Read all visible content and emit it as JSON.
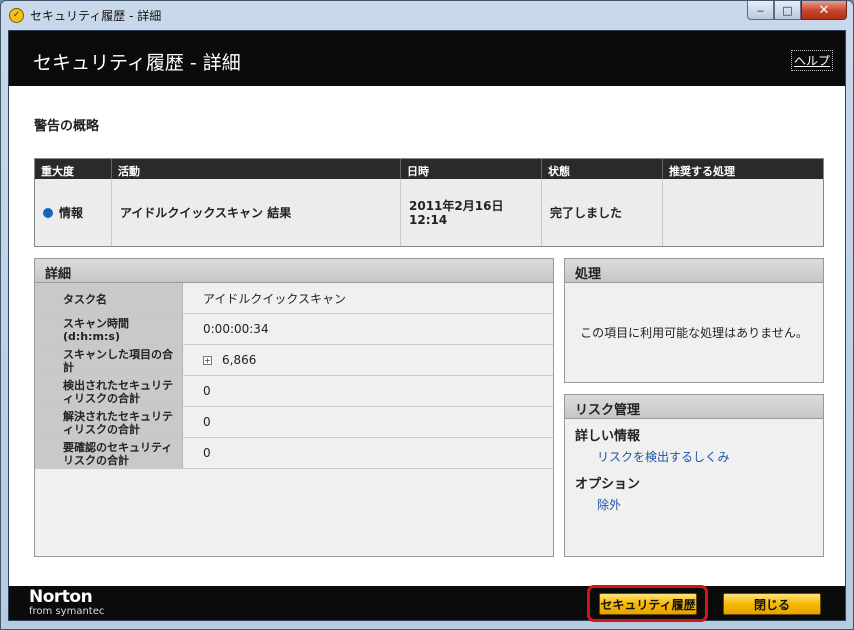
{
  "window": {
    "title": "セキュリティ履歴 - 詳細",
    "app_icon": "norton-icon",
    "controls": {
      "minimize": "‒",
      "maximize": "□",
      "close": "✕"
    }
  },
  "header": {
    "title": "セキュリティ履歴 - 詳細",
    "help_label": "ヘルプ"
  },
  "summary": {
    "title": "警告の概略",
    "columns": [
      "重大度",
      "活動",
      "日時",
      "状態",
      "推奨する処理"
    ],
    "row": {
      "severity": "情報",
      "severity_color": "#1565c0",
      "activity": "アイドルクイックスキャン 結果",
      "date_line1": "2011年2月16日",
      "date_line2": "12:14",
      "status": "完了しました",
      "recommended": ""
    }
  },
  "details": {
    "title": "詳細",
    "rows": [
      {
        "label": "タスク名",
        "value": "アイドルクイックスキャン"
      },
      {
        "label": "スキャン時間 (d:h:m:s)",
        "value": "0:00:00:34"
      },
      {
        "label": "スキャンした項目の合計",
        "value": "6,866"
      },
      {
        "label": "検出されたセキュリティリスクの合計",
        "value": "0"
      },
      {
        "label": "解決されたセキュリティリスクの合計",
        "value": "0"
      },
      {
        "label": "要確認のセキュリティリスクの合計",
        "value": "0"
      }
    ]
  },
  "action": {
    "title": "処理",
    "message": "この項目に利用可能な処理はありません。"
  },
  "risk": {
    "title": "リスク管理",
    "info_heading": "詳しい情報",
    "info_link": "リスクを検出するしくみ",
    "options_heading": "オプション",
    "options_link": "除外"
  },
  "footer": {
    "logo_main": "Norton",
    "logo_sub": "from symantec",
    "history_button": "セキュリティ履歴",
    "close_button": "閉じる"
  }
}
